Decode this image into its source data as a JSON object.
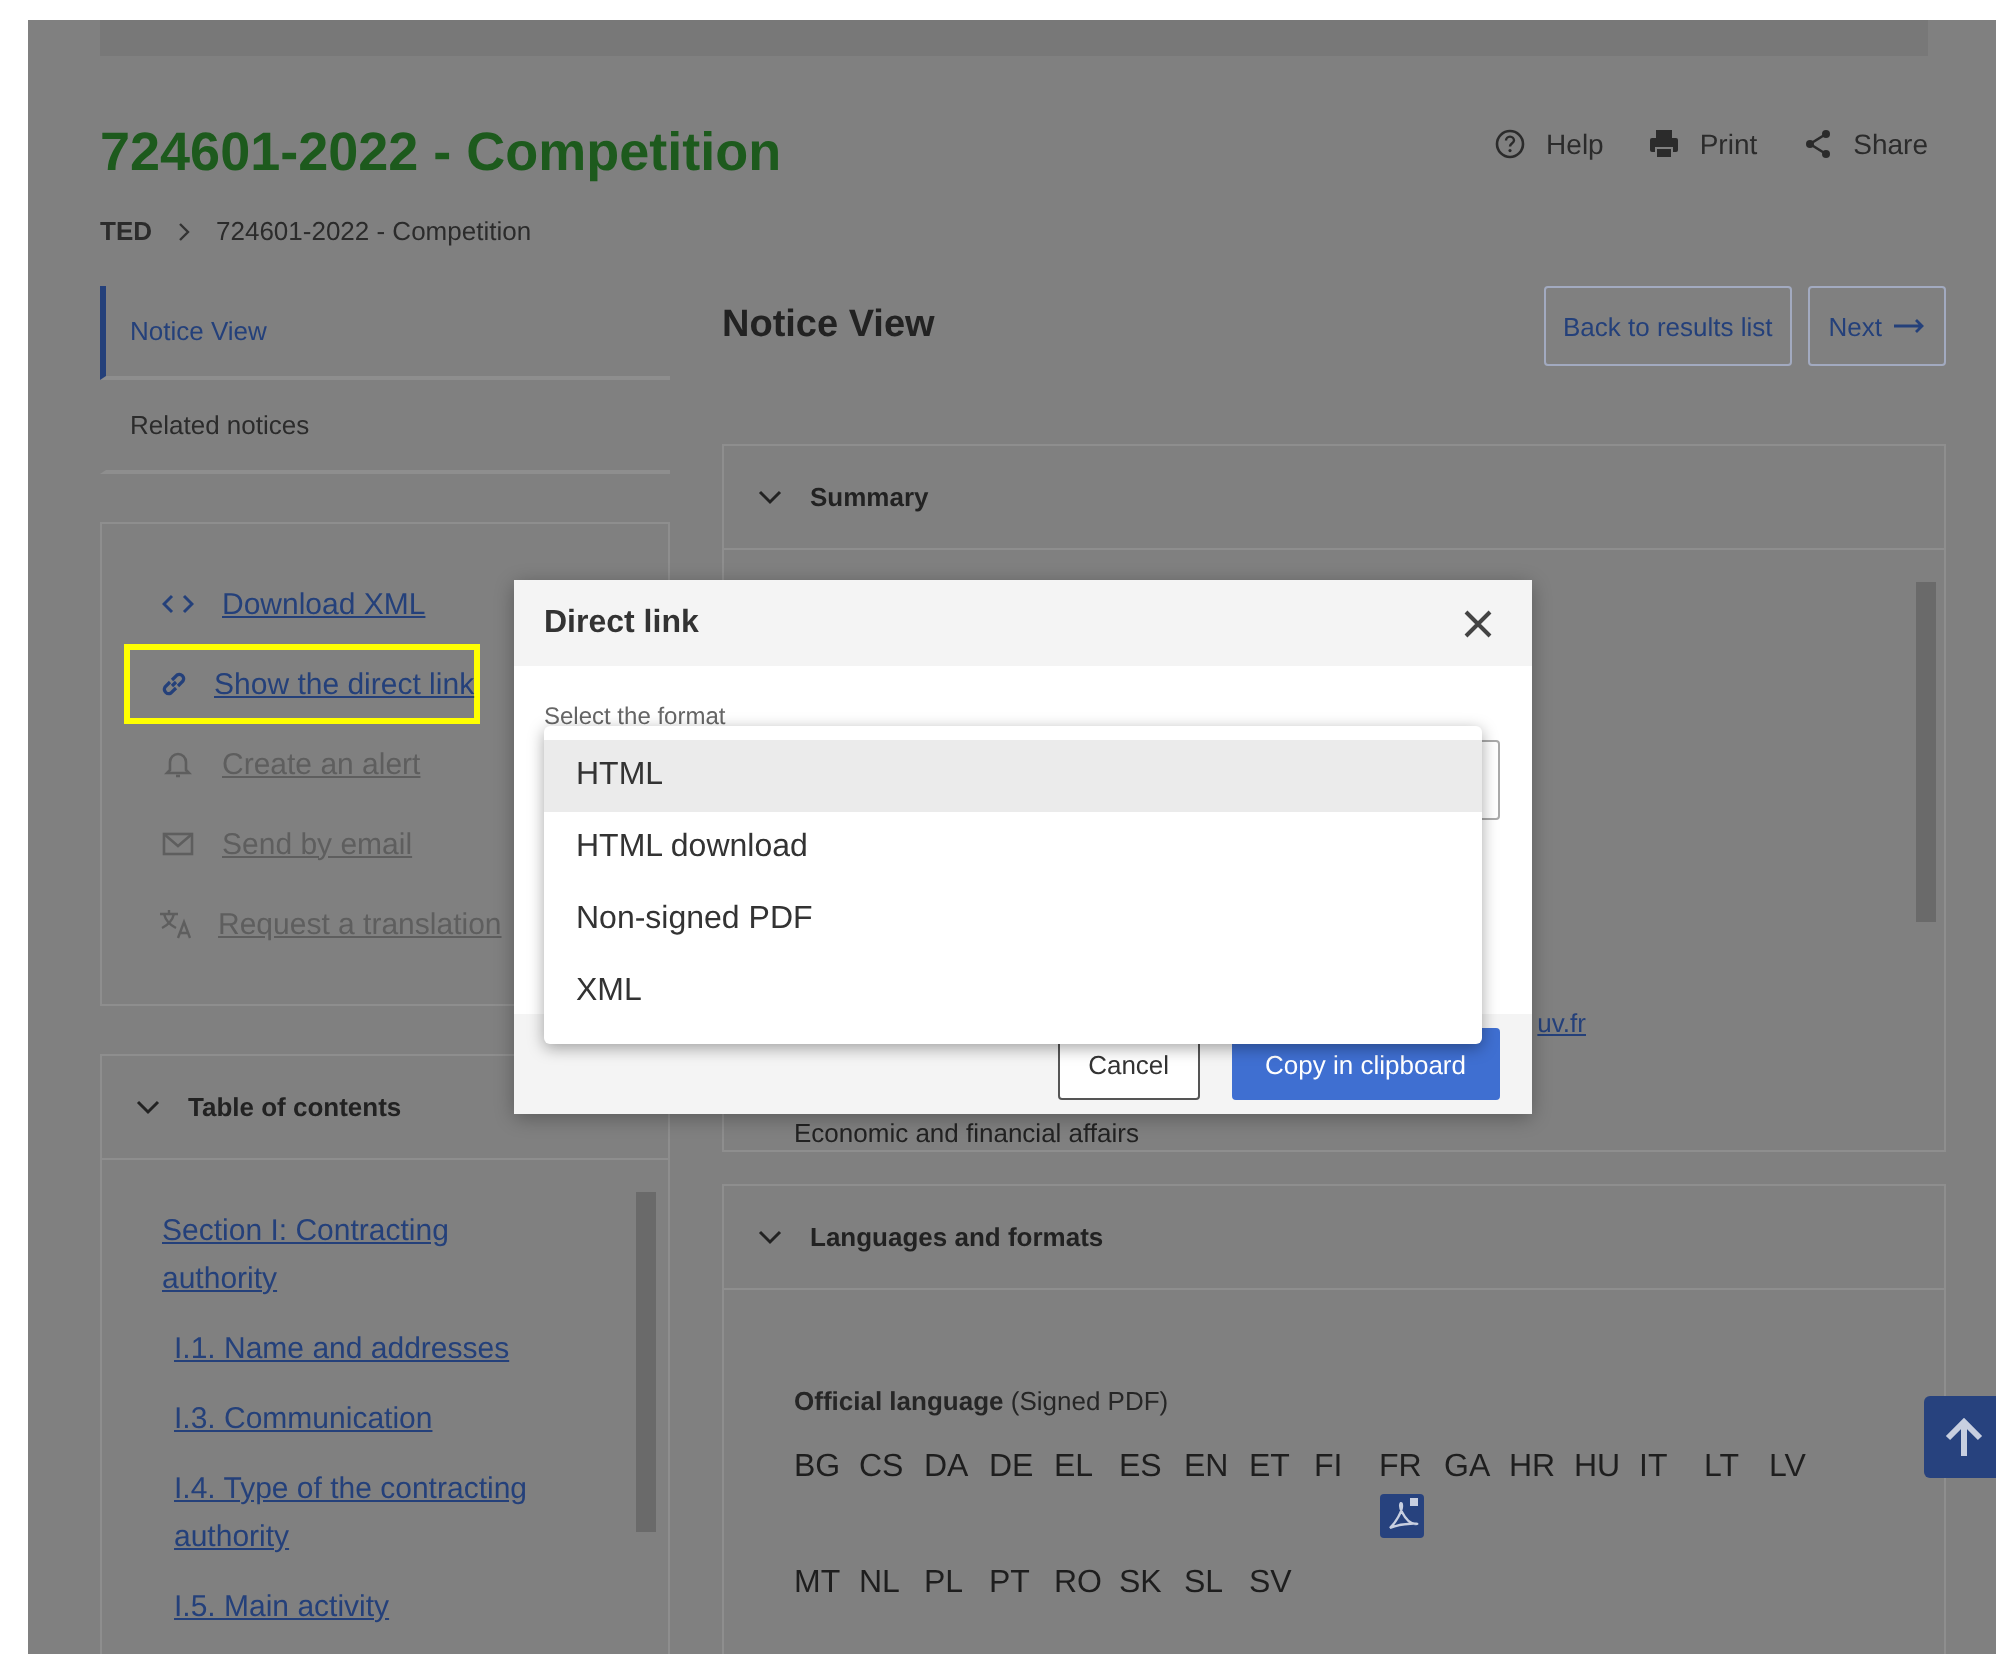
{
  "page": {
    "title": "724601-2022 - Competition",
    "header_actions": [
      {
        "kind": "help",
        "label": "Help"
      },
      {
        "kind": "print",
        "label": "Print"
      },
      {
        "kind": "share",
        "label": "Share"
      }
    ],
    "breadcrumb": [
      {
        "label": "TED"
      },
      {
        "label": "724601-2022 - Competition"
      }
    ]
  },
  "sidebar": {
    "tabs": [
      {
        "label": "Notice View",
        "selected": true
      },
      {
        "label": "Related notices",
        "selected": false
      }
    ],
    "actions": [
      {
        "kind": "code",
        "label": "Download XML",
        "disabled": false,
        "highlighted": false
      },
      {
        "kind": "link",
        "label": "Show the direct link",
        "disabled": false,
        "highlighted": true
      },
      {
        "kind": "bell",
        "label": "Create an alert",
        "disabled": true,
        "highlighted": false
      },
      {
        "kind": "mail",
        "label": "Send by email",
        "disabled": true,
        "highlighted": false
      },
      {
        "kind": "translate",
        "label": "Request a translation",
        "disabled": true,
        "highlighted": false
      }
    ],
    "toc": {
      "title": "Table of contents",
      "expanded": true,
      "items": [
        {
          "label": "Section I: Contracting authority",
          "children": [
            {
              "label": "I.1. Name and addresses"
            },
            {
              "label": "I.3. Communication"
            },
            {
              "label": "I.4. Type of the contracting authority"
            },
            {
              "label": "I.5. Main activity"
            }
          ]
        }
      ]
    }
  },
  "main": {
    "title": "Notice View",
    "buttons": [
      {
        "kind": "back",
        "label": "Back to results list"
      },
      {
        "kind": "next",
        "label": "Next"
      }
    ],
    "summary": {
      "title": "Summary",
      "expanded": true,
      "link_fragment": "uv.fr",
      "text": "Economic and financial affairs"
    },
    "languages": {
      "title": "Languages and formats",
      "expanded": true,
      "label_bold": "Official language",
      "label_rest": "(Signed PDF)",
      "codes": [
        {
          "code": "BG",
          "pdf": false
        },
        {
          "code": "CS",
          "pdf": false
        },
        {
          "code": "DA",
          "pdf": false
        },
        {
          "code": "DE",
          "pdf": false
        },
        {
          "code": "EL",
          "pdf": false
        },
        {
          "code": "ES",
          "pdf": false
        },
        {
          "code": "EN",
          "pdf": false
        },
        {
          "code": "ET",
          "pdf": false
        },
        {
          "code": "FI",
          "pdf": false
        },
        {
          "code": "FR",
          "pdf": true
        },
        {
          "code": "GA",
          "pdf": false
        },
        {
          "code": "HR",
          "pdf": false
        },
        {
          "code": "HU",
          "pdf": false
        },
        {
          "code": "IT",
          "pdf": false
        },
        {
          "code": "LT",
          "pdf": false
        },
        {
          "code": "LV",
          "pdf": false
        },
        {
          "code": "MT",
          "pdf": false
        },
        {
          "code": "NL",
          "pdf": false
        },
        {
          "code": "PL",
          "pdf": false
        },
        {
          "code": "PT",
          "pdf": false
        },
        {
          "code": "RO",
          "pdf": false
        },
        {
          "code": "SK",
          "pdf": false
        },
        {
          "code": "SL",
          "pdf": false
        },
        {
          "code": "SV",
          "pdf": false
        }
      ]
    }
  },
  "dialog": {
    "title": "Direct link",
    "field_label": "Select the format",
    "options": [
      {
        "label": "HTML",
        "selected": true
      },
      {
        "label": "HTML download",
        "selected": false
      },
      {
        "label": "Non-signed PDF",
        "selected": false
      },
      {
        "label": "XML",
        "selected": false
      }
    ],
    "buttons": [
      {
        "kind": "secondary",
        "label": "Cancel"
      },
      {
        "kind": "primary",
        "label": "Copy in clipboard"
      }
    ]
  }
}
